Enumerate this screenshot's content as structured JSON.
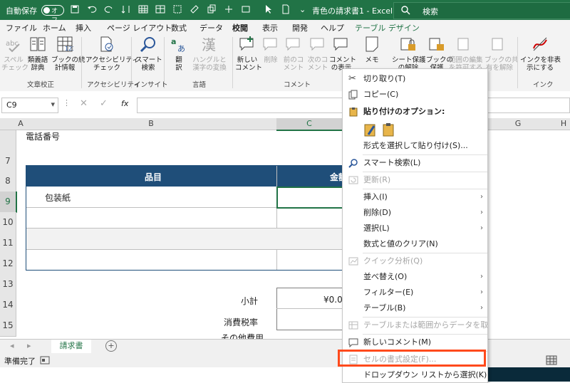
{
  "titlebar": {
    "autosave": "自動保存",
    "toggle": "オフ",
    "doc_title": "青色の請求書1 - Excel",
    "search_placeholder": "検索"
  },
  "tabs": [
    "ファイル",
    "ホーム",
    "挿入",
    "ページ レイアウト",
    "数式",
    "データ",
    "校閲",
    "表示",
    "開発",
    "ヘルプ",
    "テーブル デザイン"
  ],
  "active_tab": "校閲",
  "ribbon": {
    "spell": "スペル\nチェック",
    "thesaurus": "類義語\n辞典",
    "workbook_stats": "ブックの統\n計情報",
    "access_check": "アクセシビリティ\nチェック",
    "smart_lookup": "スマート\n検索",
    "translate": "翻\n訳",
    "hangul": "ハングルと\n漢字の変換",
    "new_comment": "新しい\nコメント",
    "delete": "削除",
    "prev_comment": "前のコ\nメント",
    "next_comment": "次のコ\nメント",
    "show_comments": "コメント\nの表示",
    "memo": "メモ",
    "protect_sheet": "シート保護\nの解除",
    "protect_book": "ブックの\n保護",
    "allow_edit": "範囲の編集\nを許可する",
    "unshare": "ブックの共\n有を解除",
    "hide_ink": "インクを非表\n示にする",
    "groups": {
      "proofing": "文章校正",
      "accessibility": "アクセシビリティ",
      "insights": "インサイト",
      "language": "言語",
      "comments": "コメント",
      "ink": "インク"
    }
  },
  "formula_bar": {
    "name_box": "C9",
    "fx": "fx"
  },
  "columns": [
    "A",
    "B",
    "C",
    "G",
    "H"
  ],
  "rows": [
    "7",
    "8",
    "9",
    "10",
    "11",
    "12",
    "13",
    "14",
    "15"
  ],
  "cells": {
    "phone": "電話番号",
    "header_item": "品目",
    "header_amount": "金額",
    "row9_item": "包装紙",
    "subtotal": "小計",
    "subtotal_value": "¥0.0",
    "tax": "消費税率",
    "other": "その他費用"
  },
  "sheet_tab": "請求書",
  "status": "準備完了",
  "context_menu": [
    {
      "label": "切り取り(T)",
      "icon": "scissors-icon",
      "enabled": true
    },
    {
      "label": "コピー(C)",
      "icon": "copy-icon",
      "enabled": true
    },
    {
      "label": "貼り付けのオプション:",
      "icon": "paste-icon",
      "enabled": true,
      "bold": true
    },
    {
      "label": "形式を選択して貼り付け(S)...",
      "enabled": true
    },
    {
      "label": "スマート検索(L)",
      "icon": "search-icon",
      "enabled": true
    },
    {
      "label": "更新(R)",
      "icon": "refresh-icon",
      "enabled": false
    },
    {
      "label": "挿入(I)",
      "enabled": true,
      "submenu": true
    },
    {
      "label": "削除(D)",
      "enabled": true,
      "submenu": true
    },
    {
      "label": "選択(L)",
      "enabled": true,
      "submenu": true
    },
    {
      "label": "数式と値のクリア(N)",
      "enabled": true
    },
    {
      "label": "クイック分析(Q)",
      "icon": "quick-analysis-icon",
      "enabled": false
    },
    {
      "label": "並べ替え(O)",
      "enabled": true,
      "submenu": true
    },
    {
      "label": "フィルター(E)",
      "enabled": true,
      "submenu": true
    },
    {
      "label": "テーブル(B)",
      "enabled": true,
      "submenu": true
    },
    {
      "label": "テーブルまたは範囲からデータを取得(G)...",
      "icon": "table-icon",
      "enabled": false
    },
    {
      "label": "新しいコメント(M)",
      "icon": "comment-icon",
      "enabled": true
    },
    {
      "label": "セルの書式設定(F)...",
      "icon": "format-cells-icon",
      "enabled": false
    },
    {
      "label": "ドロップダウン リストから選択(K)...",
      "enabled": true
    }
  ],
  "colors": {
    "excel_green": "#217346",
    "table_header": "#1f4e79",
    "highlight": "#ff4a1c"
  }
}
